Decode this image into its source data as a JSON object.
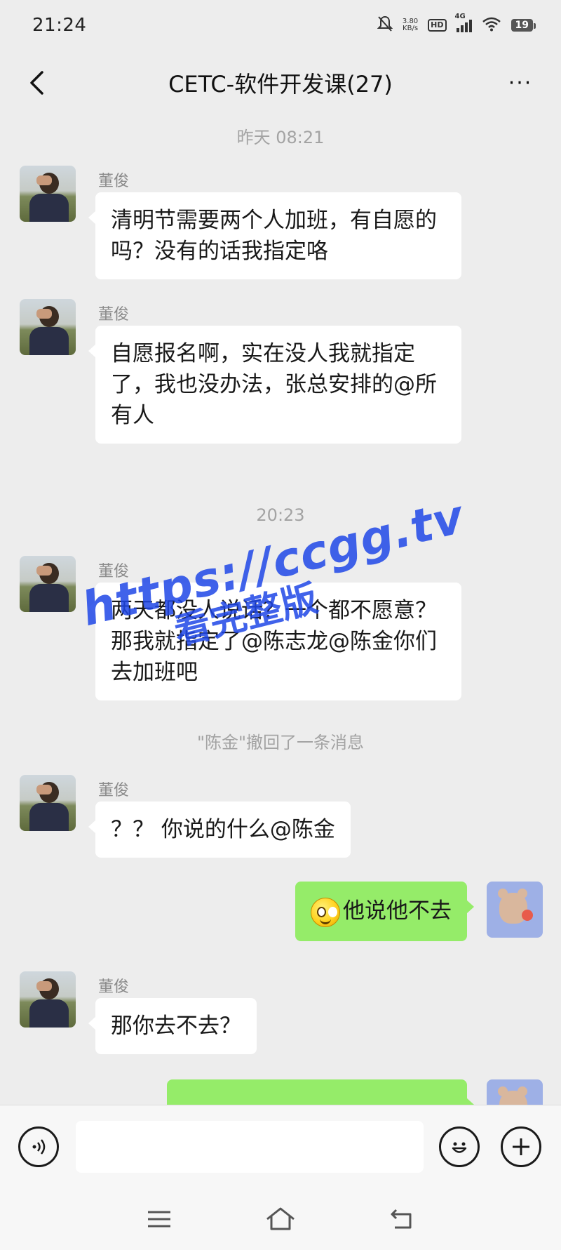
{
  "status_bar": {
    "time": "21:24",
    "net_speed": "3.80",
    "net_unit": "KB/s",
    "hd": "HD",
    "network": "4G",
    "battery": "19",
    "icons": [
      "mute-icon",
      "wifi-icon",
      "signal-icon",
      "battery-icon"
    ]
  },
  "header": {
    "title": "CETC-软件开发课(27)",
    "more": "···"
  },
  "timestamps": {
    "first": "昨天 08:21",
    "second": "20:23"
  },
  "messages": [
    {
      "sender": "董俊",
      "text": "清明节需要两个人加班，有自愿的吗？没有的话我指定咯"
    },
    {
      "sender": "董俊",
      "text": "自愿报名啊，实在没人我就指定了，我也没办法，张总安排的@所有人"
    },
    {
      "sender": "董俊",
      "text": "两天都没人说话？一个都不愿意？那我就指定了@陈志龙@陈金你们去加班吧"
    },
    {
      "sender": "董俊",
      "text": "？？ 你说的什么@陈金"
    },
    {
      "sender": "me",
      "text": "他说他不去"
    },
    {
      "sender": "董俊",
      "text": "那你去不去？"
    }
  ],
  "recall_notice": "\"陈金\"撤回了一条消息",
  "watermark": {
    "url": "https://ccgg.tv",
    "text": "看完整版"
  },
  "colors": {
    "background": "#ededed",
    "my_bubble": "#95ec69",
    "other_bubble": "#ffffff",
    "watermark": "#1e46e6"
  }
}
